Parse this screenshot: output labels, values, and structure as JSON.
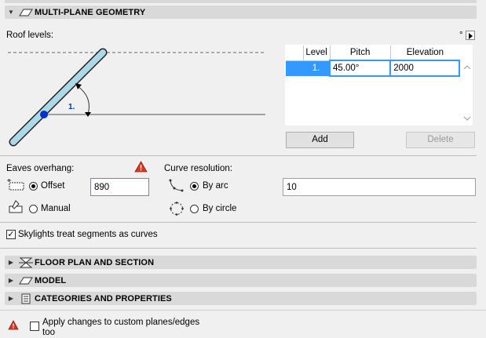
{
  "sections": {
    "multi_plane": "MULTI-PLANE GEOMETRY",
    "floor_plan": "FLOOR PLAN AND SECTION",
    "model": "MODEL",
    "categories": "CATEGORIES AND PROPERTIES"
  },
  "roof_levels": {
    "label": "Roof levels:",
    "degree_marker": "°",
    "diagram_level_label": "1.",
    "table": {
      "headers": [
        "Level",
        "Pitch",
        "Elevation"
      ],
      "rows": [
        {
          "level": "1.",
          "pitch": "45.00°",
          "elevation": "2000"
        }
      ]
    },
    "add_label": "Add",
    "delete_label": "Delete"
  },
  "eaves": {
    "label": "Eaves overhang:",
    "offset_label": "Offset",
    "offset_value": "890",
    "manual_label": "Manual",
    "selected": "offset"
  },
  "curve": {
    "label": "Curve resolution:",
    "by_arc_label": "By arc",
    "by_circle_label": "By circle",
    "arc_value": "10",
    "selected": "by_arc"
  },
  "skylights": {
    "label": "Skylights treat segments as curves",
    "checked": true
  },
  "apply_changes": {
    "label_line1": "Apply changes to custom planes/edges",
    "label_line2": "too",
    "checked": false
  },
  "colors": {
    "accent": "#3399ff",
    "selection": "#3399ff",
    "warning": "#d9381e",
    "diagram_blue": "#0033cc"
  }
}
